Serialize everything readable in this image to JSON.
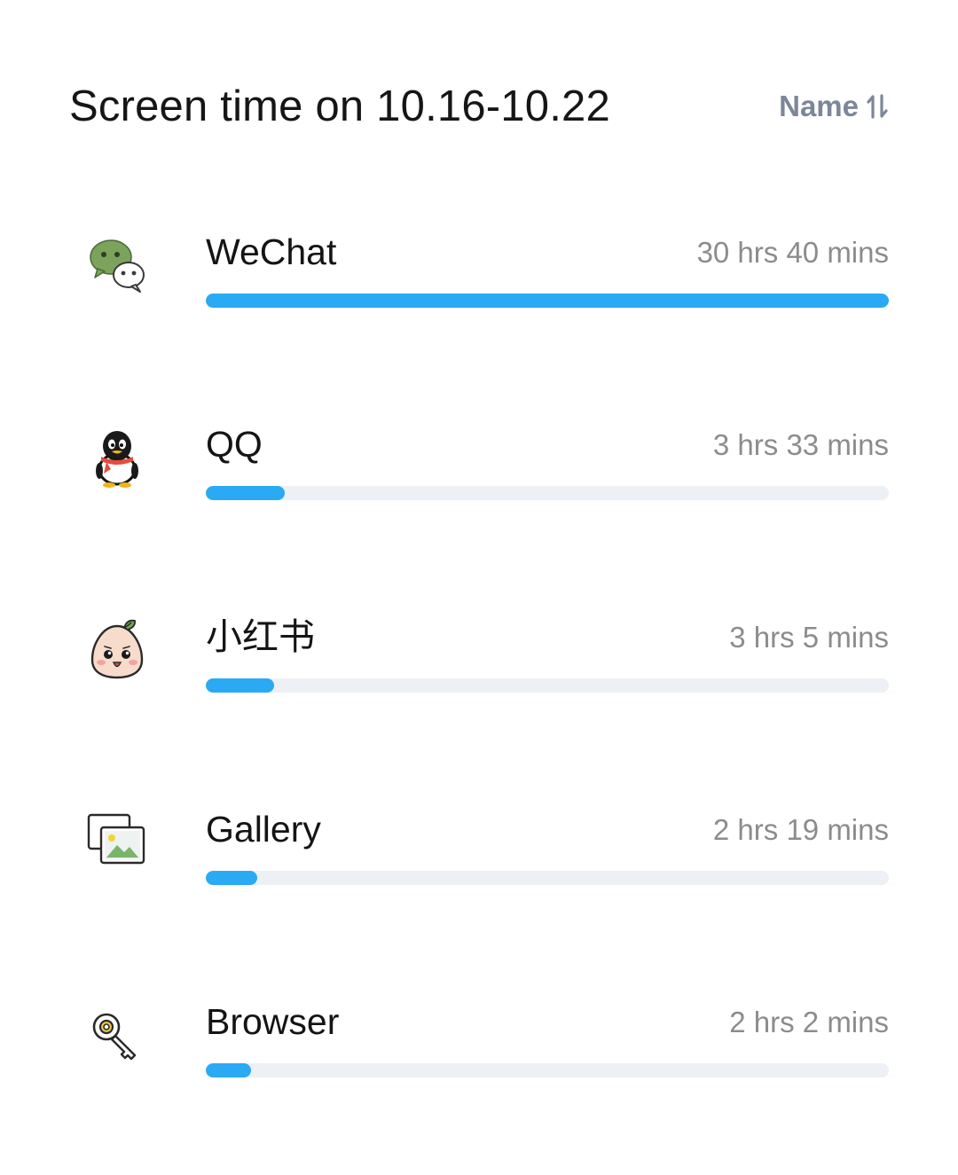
{
  "header": {
    "title": "Screen time on 10.16-10.22",
    "sort_label": "Name",
    "sort_icon": "sort-arrows-icon",
    "sort_color": "#7d879a"
  },
  "colors": {
    "bar_fill": "#2aa9f5",
    "bar_track": "#edf0f5"
  },
  "apps": [
    {
      "name": "WeChat",
      "time": "30 hrs 40 mins",
      "minutes": 1840,
      "icon": "wechat-icon"
    },
    {
      "name": "QQ",
      "time": "3 hrs 33 mins",
      "minutes": 213,
      "icon": "qq-penguin-icon"
    },
    {
      "name": "小红书",
      "time": "3 hrs 5 mins",
      "minutes": 185,
      "icon": "xiaohongshu-icon"
    },
    {
      "name": "Gallery",
      "time": "2 hrs 19 mins",
      "minutes": 139,
      "icon": "gallery-icon"
    },
    {
      "name": "Browser",
      "time": "2 hrs 2 mins",
      "minutes": 122,
      "icon": "browser-key-icon"
    }
  ]
}
